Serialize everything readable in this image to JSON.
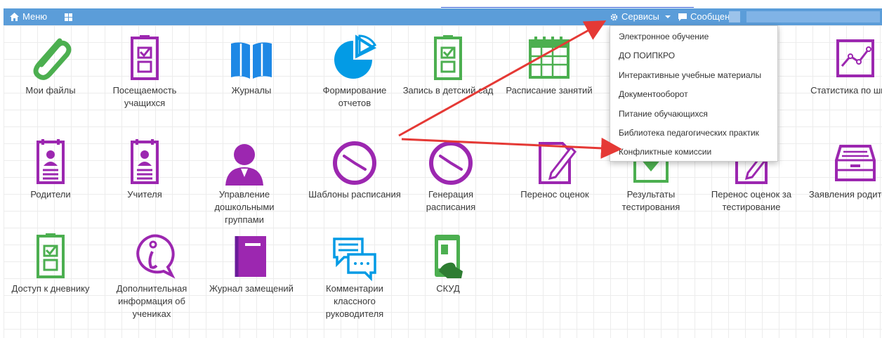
{
  "topbar": {
    "menu_label": "Меню",
    "services_label": "Сервисы",
    "messages_label": "Сообщения"
  },
  "tiles": [
    {
      "label": "Мои файлы",
      "icon": "paperclip-icon"
    },
    {
      "label": "Посещаемость учащихся",
      "icon": "clipboard-check-icon"
    },
    {
      "label": "Журналы",
      "icon": "open-book-icon"
    },
    {
      "label": "Формирование отчетов",
      "icon": "pie-chart-icon"
    },
    {
      "label": "Запись в детский сад",
      "icon": "clipboard-check-icon"
    },
    {
      "label": "Расписание занятий",
      "icon": "calendar-icon"
    },
    {
      "label": "Статистика по школе",
      "icon": "line-graph-icon"
    },
    {
      "label": "Родители",
      "icon": "profile-card-icon"
    },
    {
      "label": "Учителя",
      "icon": "profile-card-icon"
    },
    {
      "label": "Управление дошкольными группами",
      "icon": "person-icon"
    },
    {
      "label": "Шаблоны расписания",
      "icon": "clock-icon"
    },
    {
      "label": "Генерация расписания",
      "icon": "clock-icon"
    },
    {
      "label": "Перенос оценок",
      "icon": "pencil-document-icon"
    },
    {
      "label": "Результаты тестирования",
      "icon": "download-icon"
    },
    {
      "label": "Перенос оценок за тестирование",
      "icon": "pencil-document-icon"
    },
    {
      "label": "Заявления родителей",
      "icon": "inbox-tray-icon"
    },
    {
      "label": "Доступ к дневнику",
      "icon": "clipboard-check-icon"
    },
    {
      "label": "Дополнительная информация об учениках",
      "icon": "info-bubble-icon"
    },
    {
      "label": "Журнал замещений",
      "icon": "book-icon"
    },
    {
      "label": "Комментарии классного руководителя",
      "icon": "chat-bubbles-icon"
    },
    {
      "label": "СКУД",
      "icon": "tablet-hand-icon"
    }
  ],
  "dropdown": [
    {
      "label": "Электронное обучение"
    },
    {
      "label": "ДО ПОИПКРО"
    },
    {
      "label": "Интерактивные учебные материалы"
    },
    {
      "label": "Документооборот"
    },
    {
      "label": "Питание обучающихся"
    },
    {
      "label": "Библиотека педагогических практик"
    },
    {
      "label": "Конфликтные комиссии"
    }
  ],
  "colors": {
    "topbar": "#5b9dd9",
    "green": "#4caf50",
    "purple": "#9c27b0",
    "blue": "#1e88e5",
    "annotation_arrow": "#e53935"
  }
}
